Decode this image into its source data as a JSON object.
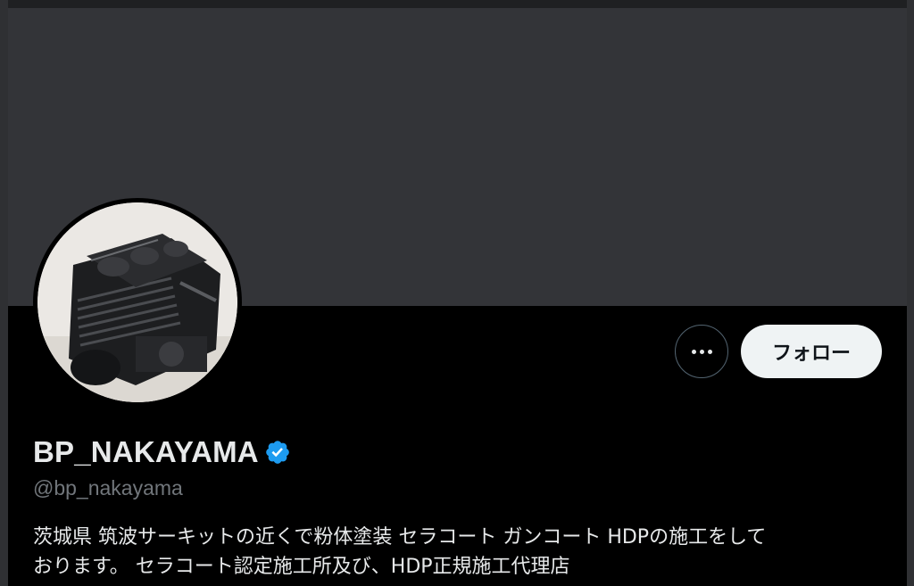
{
  "profile": {
    "display_name": "BP_NAKAYAMA",
    "handle": "@bp_nakayama",
    "verified": true,
    "bio_lines": [
      "茨城県 筑波サーキットの近くで粉体塗装 セラコート ガンコート HDPの施工をして",
      "おります。 セラコート認定施工所及び、HDP正規施工代理店"
    ]
  },
  "actions": {
    "more_icon": "more-horizontal-icon",
    "follow_label": "フォロー"
  },
  "colors": {
    "background": "#000000",
    "banner": "#333438",
    "verified_badge": "#1d9bf0",
    "follow_button_bg": "#eff3f4",
    "primary_text": "#e7e9ea",
    "secondary_text": "#71767b"
  }
}
